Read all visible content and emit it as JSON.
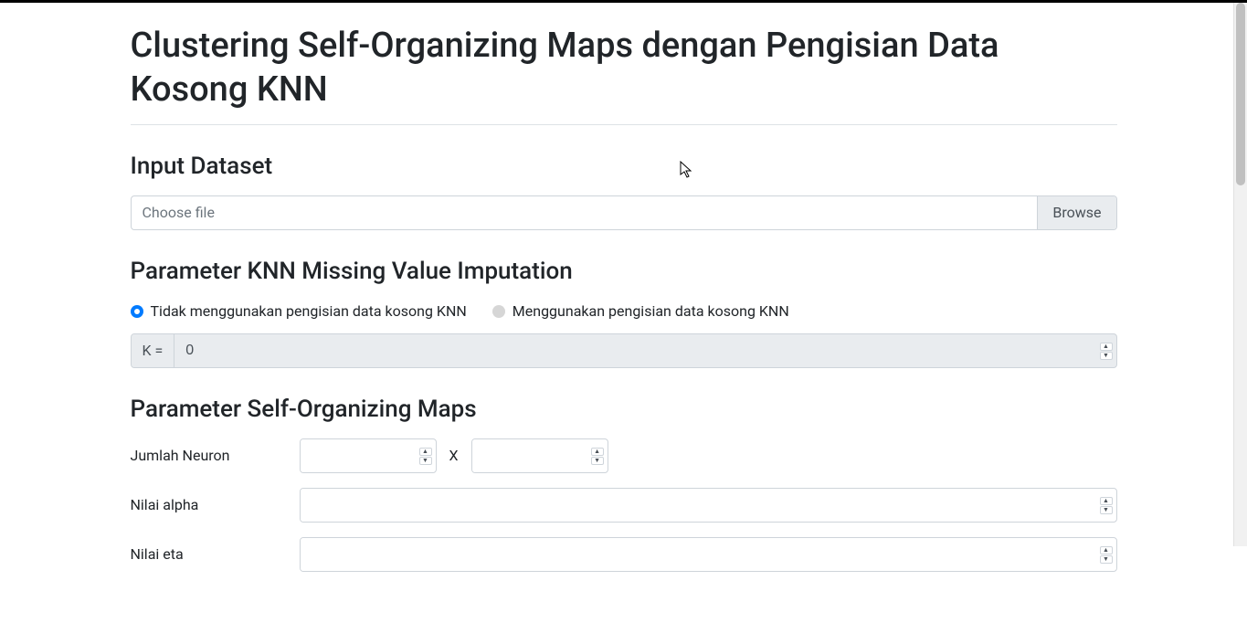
{
  "page": {
    "title": "Clustering Self-Organizing Maps dengan Pengisian Data Kosong KNN"
  },
  "sections": {
    "input_dataset": {
      "heading": "Input Dataset",
      "file": {
        "placeholder": "Choose file",
        "browse_label": "Browse"
      }
    },
    "knn": {
      "heading": "Parameter KNN Missing Value Imputation",
      "radio": {
        "opt_no": "Tidak menggunakan pengisian data kosong KNN",
        "opt_yes": "Menggunakan pengisian data kosong KNN",
        "selected": "no"
      },
      "k_prefix": "K =",
      "k_value": "0"
    },
    "som": {
      "heading": "Parameter Self-Organizing Maps",
      "labels": {
        "neurons": "Jumlah Neuron",
        "x_sep": "X",
        "alpha": "Nilai alpha",
        "eta": "Nilai eta"
      },
      "values": {
        "neuron_rows": "",
        "neuron_cols": "",
        "alpha": "",
        "eta": ""
      }
    }
  }
}
